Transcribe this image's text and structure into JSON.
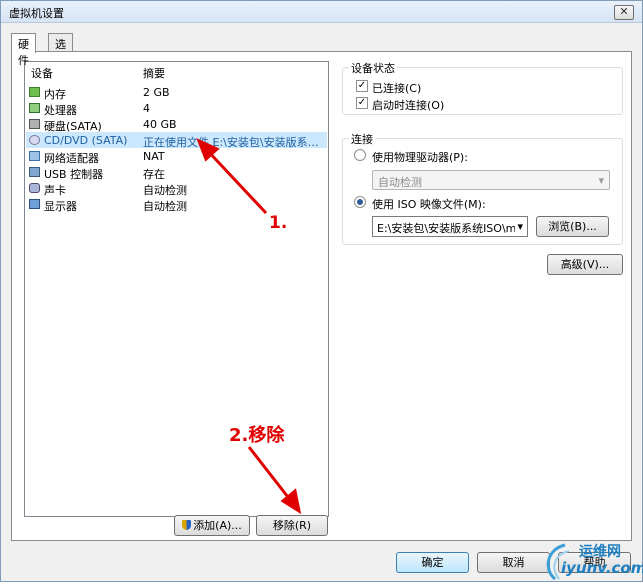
{
  "window": {
    "title": "虚拟机设置",
    "close_label": "✕"
  },
  "tabs": [
    {
      "label": "硬件"
    },
    {
      "label": "选项"
    }
  ],
  "device_list": {
    "columns": {
      "device": "设备",
      "summary": "摘要"
    },
    "rows": [
      {
        "name": "内存",
        "summary": "2 GB",
        "icon": "memory-icon"
      },
      {
        "name": "处理器",
        "summary": "4",
        "icon": "processor-icon"
      },
      {
        "name": "硬盘(SATA)",
        "summary": "40 GB",
        "icon": "hard-disk-icon"
      },
      {
        "name": "CD/DVD (SATA)",
        "summary": "正在使用文件 E:\\安装包\\安装版系统...",
        "icon": "cd-dvd-icon"
      },
      {
        "name": "网络适配器",
        "summary": "NAT",
        "icon": "network-adapter-icon"
      },
      {
        "name": "USB 控制器",
        "summary": "存在",
        "icon": "usb-icon"
      },
      {
        "name": "声卡",
        "summary": "自动检测",
        "icon": "sound-card-icon"
      },
      {
        "name": "显示器",
        "summary": "自动检测",
        "icon": "display-icon"
      }
    ],
    "add_button": "添加(A)...",
    "remove_button": "移除(R)"
  },
  "device_status": {
    "legend": "设备状态",
    "connected_label": "已连接(C)",
    "connect_at_power_on_label": "启动时连接(O)",
    "connected_checked": true,
    "connect_at_power_on_checked": true
  },
  "connection": {
    "legend": "连接",
    "physical_drive_label": "使用物理驱动器(P):",
    "physical_drive_value": "自动检测",
    "iso_label": "使用 ISO 映像文件(M):",
    "iso_value": "E:\\安装包\\安装版系统ISO\\m",
    "browse_button": "浏览(B)...",
    "advanced_button": "高级(V)..."
  },
  "footer": {
    "ok_button": "确定",
    "cancel_button": "取消",
    "help_button": "帮助"
  },
  "annotations": {
    "step1": "1.",
    "step2": "2.移除"
  },
  "watermark": {
    "text_cn": "运维网",
    "text_en": "iyunv.com"
  },
  "colors": {
    "selection": "#cce8ff",
    "annotation": "#e00000",
    "accent": "#3c7fb1"
  }
}
